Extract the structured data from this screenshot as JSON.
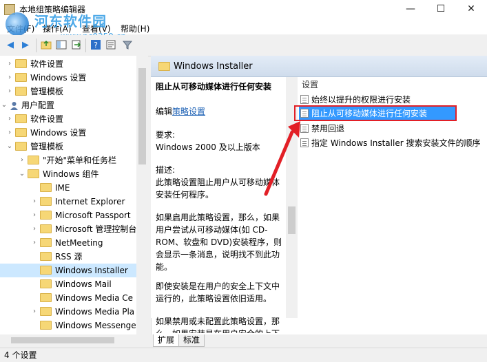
{
  "window": {
    "title": "本地组策略编辑器",
    "min": "—",
    "max": "☐",
    "close": "✕"
  },
  "watermark": {
    "brand": "河东软件园",
    "url": "www.pc0359.cn"
  },
  "menu": {
    "file": "文件(F)",
    "action": "操作(A)",
    "view": "查看(V)",
    "help": "帮助(H)"
  },
  "toolbar": {
    "icons": [
      "back-icon",
      "forward-icon",
      "up-folder-icon",
      "show-hide-tree-icon",
      "export-list-icon",
      "help-icon",
      "properties-icon",
      "filter-icon"
    ]
  },
  "tree": {
    "rows": [
      {
        "label": "软件设置",
        "expander": "›",
        "indent": 8,
        "icon": "folder"
      },
      {
        "label": "Windows 设置",
        "expander": "›",
        "indent": 8,
        "icon": "folder"
      },
      {
        "label": "管理模板",
        "expander": "›",
        "indent": 8,
        "icon": "folder"
      },
      {
        "label": "用户配置",
        "expander": "⌄",
        "indent": 0,
        "icon": "user"
      },
      {
        "label": "软件设置",
        "expander": "›",
        "indent": 8,
        "icon": "folder"
      },
      {
        "label": "Windows 设置",
        "expander": "›",
        "indent": 8,
        "icon": "folder"
      },
      {
        "label": "管理模板",
        "expander": "⌄",
        "indent": 8,
        "icon": "folder"
      },
      {
        "label": "\"开始\"菜单和任务栏",
        "expander": "›",
        "indent": 26,
        "icon": "folder"
      },
      {
        "label": "Windows 组件",
        "expander": "⌄",
        "indent": 26,
        "icon": "folder"
      },
      {
        "label": "IME",
        "expander": "",
        "indent": 44,
        "icon": "folder"
      },
      {
        "label": "Internet Explorer",
        "expander": "›",
        "indent": 44,
        "icon": "folder"
      },
      {
        "label": "Microsoft Passport",
        "expander": "›",
        "indent": 44,
        "icon": "folder"
      },
      {
        "label": "Microsoft 管理控制台",
        "expander": "›",
        "indent": 44,
        "icon": "folder"
      },
      {
        "label": "NetMeeting",
        "expander": "›",
        "indent": 44,
        "icon": "folder"
      },
      {
        "label": "RSS 源",
        "expander": "",
        "indent": 44,
        "icon": "folder"
      },
      {
        "label": "Windows Installer",
        "expander": "",
        "indent": 44,
        "icon": "folder",
        "selected": true
      },
      {
        "label": "Windows Mail",
        "expander": "",
        "indent": 44,
        "icon": "folder"
      },
      {
        "label": "Windows Media Ce",
        "expander": "",
        "indent": 44,
        "icon": "folder"
      },
      {
        "label": "Windows Media Pla",
        "expander": "›",
        "indent": 44,
        "icon": "folder"
      },
      {
        "label": "Windows Messenge",
        "expander": "",
        "indent": 44,
        "icon": "folder"
      }
    ]
  },
  "right": {
    "header_title": "Windows Installer",
    "description": {
      "heading": "阻止从可移动媒体进行任何安装",
      "edit_prefix": "编辑",
      "edit_link": "策略设置",
      "req_label": "要求:",
      "req_value": "Windows 2000 及以上版本",
      "desc_label": "描述:",
      "desc_text": "此策略设置阻止用户从可移动媒体安装任何程序。",
      "p_enabled": "如果启用此策略设置，那么，如果用户尝试从可移动媒体(如 CD-ROM、软盘和 DVD)安装程序，则会显示一条消息，说明找不到此功能。",
      "p_apply": "即使安装是在用户的安全上下文中运行的，此策略设置依旧适用。",
      "p_disabled": "如果禁用或未配置此策略设置，那么，如果安装是在用户安全的上下文"
    },
    "list": {
      "header": "设置",
      "items": [
        "始终以提升的权限进行安装",
        "阻止从可移动媒体进行任何安装",
        "禁用回退",
        "指定 Windows Installer 搜索安装文件的顺序"
      ]
    },
    "tabs": {
      "extended": "扩展",
      "standard": "标准"
    }
  },
  "status": {
    "text": "4 个设置"
  },
  "colors": {
    "selection": "#3399ff",
    "annotation": "#e21f26",
    "header": "#d6e2f0"
  }
}
